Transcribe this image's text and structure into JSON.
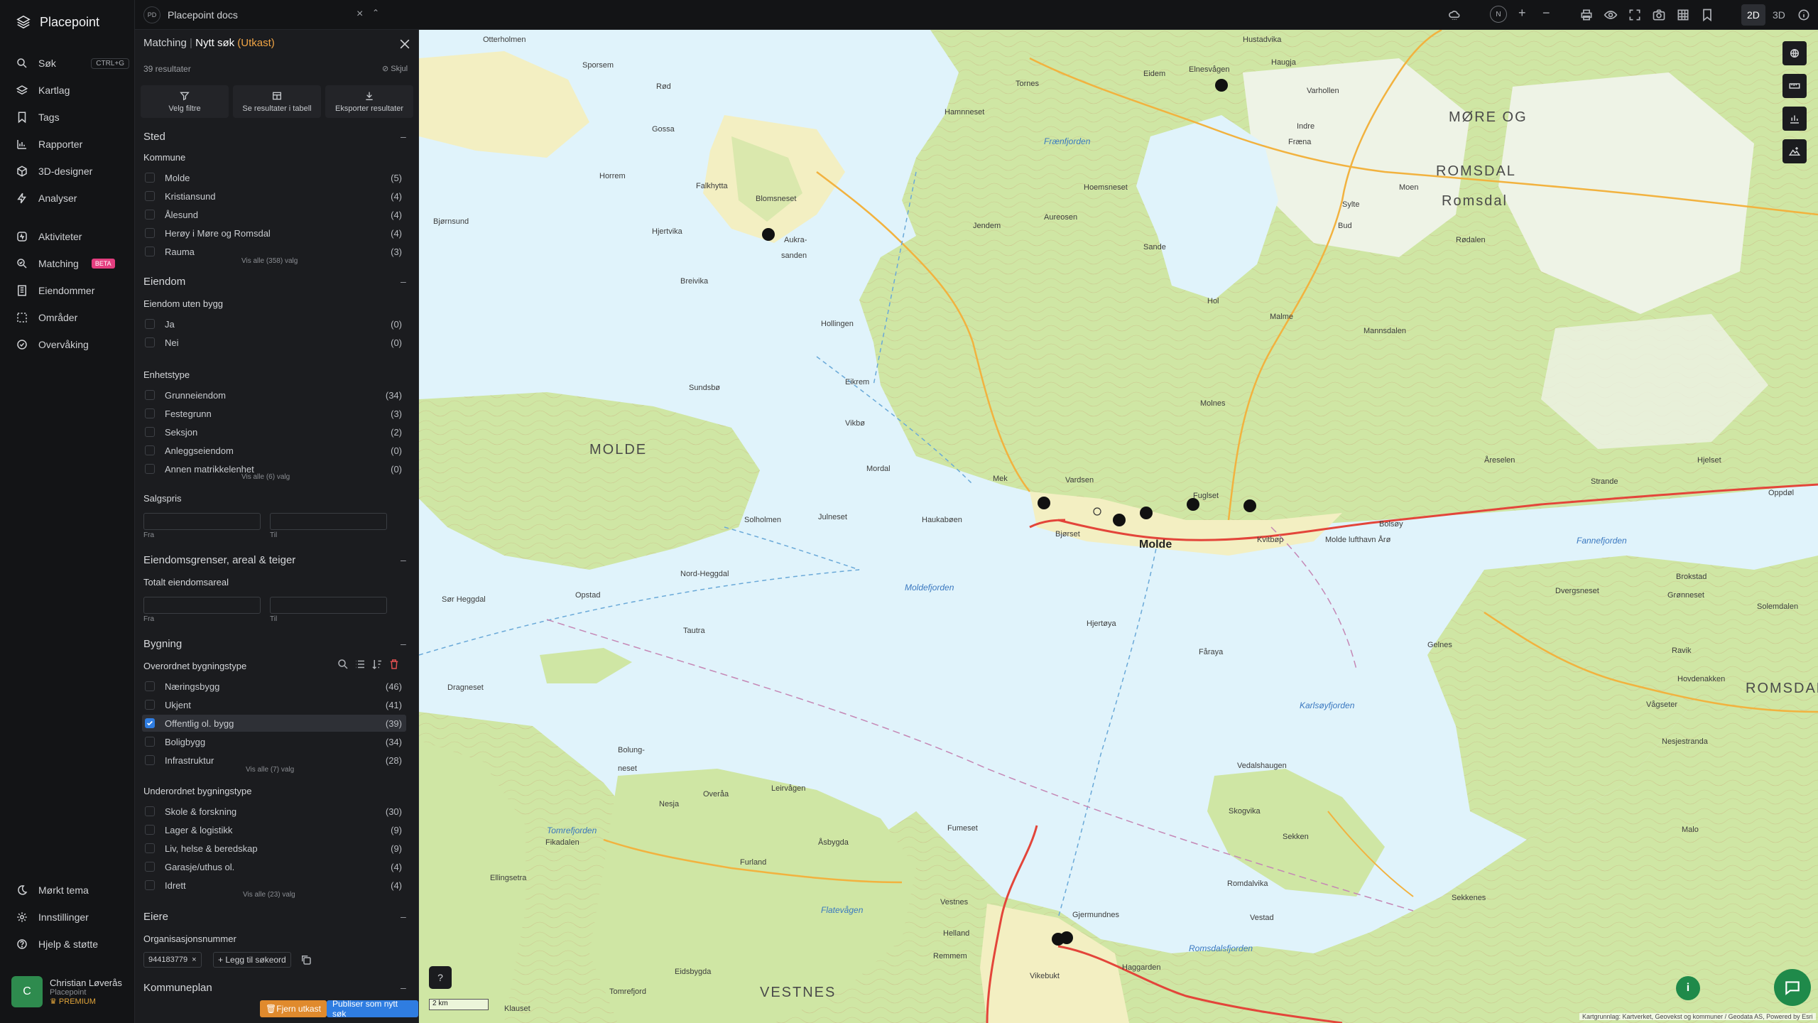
{
  "nav": {
    "brand": "Placepoint",
    "items": [
      {
        "label": "Søk",
        "icon": "search-icon",
        "kbd": "CTRL+G"
      },
      {
        "label": "Kartlag",
        "icon": "layers-icon"
      },
      {
        "label": "Tags",
        "icon": "bookmark-icon"
      },
      {
        "label": "Rapporter",
        "icon": "chart-icon"
      },
      {
        "label": "3D-designer",
        "icon": "cube-icon"
      },
      {
        "label": "Analyser",
        "icon": "bolt-icon"
      },
      {
        "label": "Aktiviteter",
        "icon": "activity-icon"
      },
      {
        "label": "Matching",
        "icon": "match-icon",
        "badge": "BETA"
      },
      {
        "label": "Eiendommer",
        "icon": "building-icon"
      },
      {
        "label": "Områder",
        "icon": "area-icon"
      },
      {
        "label": "Overvåking",
        "icon": "monitor-icon"
      }
    ],
    "bottom": [
      {
        "label": "Mørkt tema",
        "icon": "moon-icon"
      },
      {
        "label": "Innstillinger",
        "icon": "gear-icon"
      },
      {
        "label": "Hjelp & støtte",
        "icon": "help-icon"
      }
    ],
    "user": {
      "initial": "C",
      "name": "Christian Løverås",
      "org": "Placepoint",
      "plan": "PREMIUM"
    }
  },
  "topbar": {
    "doc_badge": "PD",
    "doc_title": "Placepoint docs",
    "north": "N",
    "zoom_in": "+",
    "zoom_out": "−",
    "mode_2d": "2D",
    "mode_3d": "3D"
  },
  "panel": {
    "crumb": "Matching",
    "title": "Nytt søk",
    "status": "(Utkast)",
    "result_count": "39 resultater",
    "hide": "Skjul",
    "actions": [
      "Velg filtre",
      "Se resultater i tabell",
      "Eksporter resultater"
    ],
    "sted": {
      "title": "Sted",
      "kommune_label": "Kommune",
      "kommuner": [
        {
          "name": "Molde",
          "count": "(5)"
        },
        {
          "name": "Kristiansund",
          "count": "(4)"
        },
        {
          "name": "Ålesund",
          "count": "(4)"
        },
        {
          "name": "Herøy i Møre og Romsdal",
          "count": "(4)"
        },
        {
          "name": "Rauma",
          "count": "(3)"
        }
      ],
      "show_all": "Vis alle (358) valg"
    },
    "eiendom": {
      "title": "Eiendom",
      "uten_bygg_label": "Eiendom uten bygg",
      "uten_bygg": [
        {
          "name": "Ja",
          "count": "(0)"
        },
        {
          "name": "Nei",
          "count": "(0)"
        }
      ],
      "enhetstype_label": "Enhetstype",
      "enhetstyper": [
        {
          "name": "Grunneiendom",
          "count": "(34)"
        },
        {
          "name": "Festegrunn",
          "count": "(3)"
        },
        {
          "name": "Seksjon",
          "count": "(2)"
        },
        {
          "name": "Anleggseiendom",
          "count": "(0)"
        },
        {
          "name": "Annen matrikkelenhet",
          "count": "(0)"
        }
      ],
      "show_all": "Vis alle (6) valg",
      "salgspris_label": "Salgspris",
      "from": "Fra",
      "to": "Til"
    },
    "grenser": {
      "title": "Eiendomsgrenser, areal & teiger",
      "areal_label": "Totalt eiendomsareal",
      "from": "Fra",
      "to": "Til"
    },
    "bygning": {
      "title": "Bygning",
      "over_label": "Overordnet bygningstype",
      "over": [
        {
          "name": "Næringsbygg",
          "count": "(46)"
        },
        {
          "name": "Ukjent",
          "count": "(41)"
        },
        {
          "name": "Offentlig ol. bygg",
          "count": "(39)"
        },
        {
          "name": "Boligbygg",
          "count": "(34)"
        },
        {
          "name": "Infrastruktur",
          "count": "(28)"
        }
      ],
      "over_show_all": "Vis alle (7) valg",
      "under_label": "Underordnet bygningstype",
      "under": [
        {
          "name": "Skole & forskning",
          "count": "(30)"
        },
        {
          "name": "Lager & logistikk",
          "count": "(9)"
        },
        {
          "name": "Liv, helse & beredskap",
          "count": "(9)"
        },
        {
          "name": "Garasje/uthus ol.",
          "count": "(4)"
        },
        {
          "name": "Idrett",
          "count": "(4)"
        }
      ],
      "under_show_all": "Vis alle (23) valg"
    },
    "eiere": {
      "title": "Eiere",
      "org_label": "Organisasjonsnummer",
      "chip": "944183779",
      "chip_x": "×",
      "add_keyword": "+ Legg til søkeord"
    },
    "kommuneplan": {
      "title": "Kommuneplan"
    },
    "buttons": {
      "remove_draft": "Fjern utkast",
      "publish": "Publiser som nytt søk"
    },
    "collapse_symbol": "–"
  },
  "map": {
    "regions": [
      "MØRE OG",
      "ROMSDAL",
      "MOLDE",
      "ROMSDAL",
      "VESTNES"
    ],
    "town": "Molde",
    "places": [
      "Otterholmen",
      "Sporsem",
      "Rød",
      "Gossa",
      "Hustadvika",
      "Elnesvågen",
      "Eidem",
      "Haugja",
      "Tornes",
      "Hamnneset",
      "Frænfjorden",
      "Varhollen",
      "Indre",
      "Fræna",
      "Sylte",
      "Bud",
      "Moen",
      "Rødalen",
      "Romsdal",
      "Aukra-",
      "sanden",
      "Bjørnsund",
      "Blomsneset",
      "Horrem",
      "Falkhytta",
      "Hjertvika",
      "Breivika",
      "Hollingen",
      "Jendem",
      "Aureosen",
      "Hoemsneset",
      "Sande",
      "Hol",
      "Malme",
      "Mannsdalen",
      "Molnes",
      "Eikrem",
      "Sundsbø",
      "Mordal",
      "Vikbø",
      "Mek",
      "Vardsen",
      "Fuglset",
      "Kvitbøp",
      "Molde lufthavn Årø",
      "Bolsøy",
      "Haukabøen",
      "Julneset",
      "Solholmen",
      "Bjørset",
      "Nord-Heggdal",
      "Opstad",
      "Sør Heggdal",
      "Tautra",
      "Hjertøya",
      "Fåraya",
      "Gelnes",
      "Karlsøyfjorden",
      "Moldefjorden",
      "Dragneset",
      "Bolung-",
      "neset",
      "Nesja",
      "Leirvågen",
      "Overåa",
      "Furland",
      "Åsbygda",
      "Fumeset",
      "Vestnes",
      "Helland",
      "Remmem",
      "Gjermundnes",
      "Haggarden",
      "Vikebukt",
      "Tomrefjorden",
      "Vedalshaugen",
      "Skogvika",
      "Sekken",
      "Romdalvika",
      "Vestad",
      "Sekkenes",
      "Romsdalsfjorden",
      "Fannefjorden",
      "Brokstad",
      "Grønneset",
      "Dvergsneset",
      "Solemdalen",
      "Ravik",
      "Hovdenakken",
      "Vågseter",
      "Nesjestranda",
      "Malo",
      "Strande",
      "Oppdøl",
      "Hjelset",
      "Åreselen",
      "Fikadalen",
      "Ellingsetra",
      "Flatevågen",
      "Eidsbygda",
      "Tomrefjord",
      "Klauset"
    ],
    "scale": "2 km",
    "attribution": "Kartgrunnlag: Kartverket, Geovekst og kommuner / Geodata AS, Powered by Esri"
  },
  "colors": {
    "accent": "#2f7de1",
    "draft": "#f0a445",
    "remove": "#e08a2d",
    "publish": "#2f7de1",
    "beta": "#e33e7f",
    "premium": "#e0a43a",
    "info": "#1f8a4a"
  }
}
